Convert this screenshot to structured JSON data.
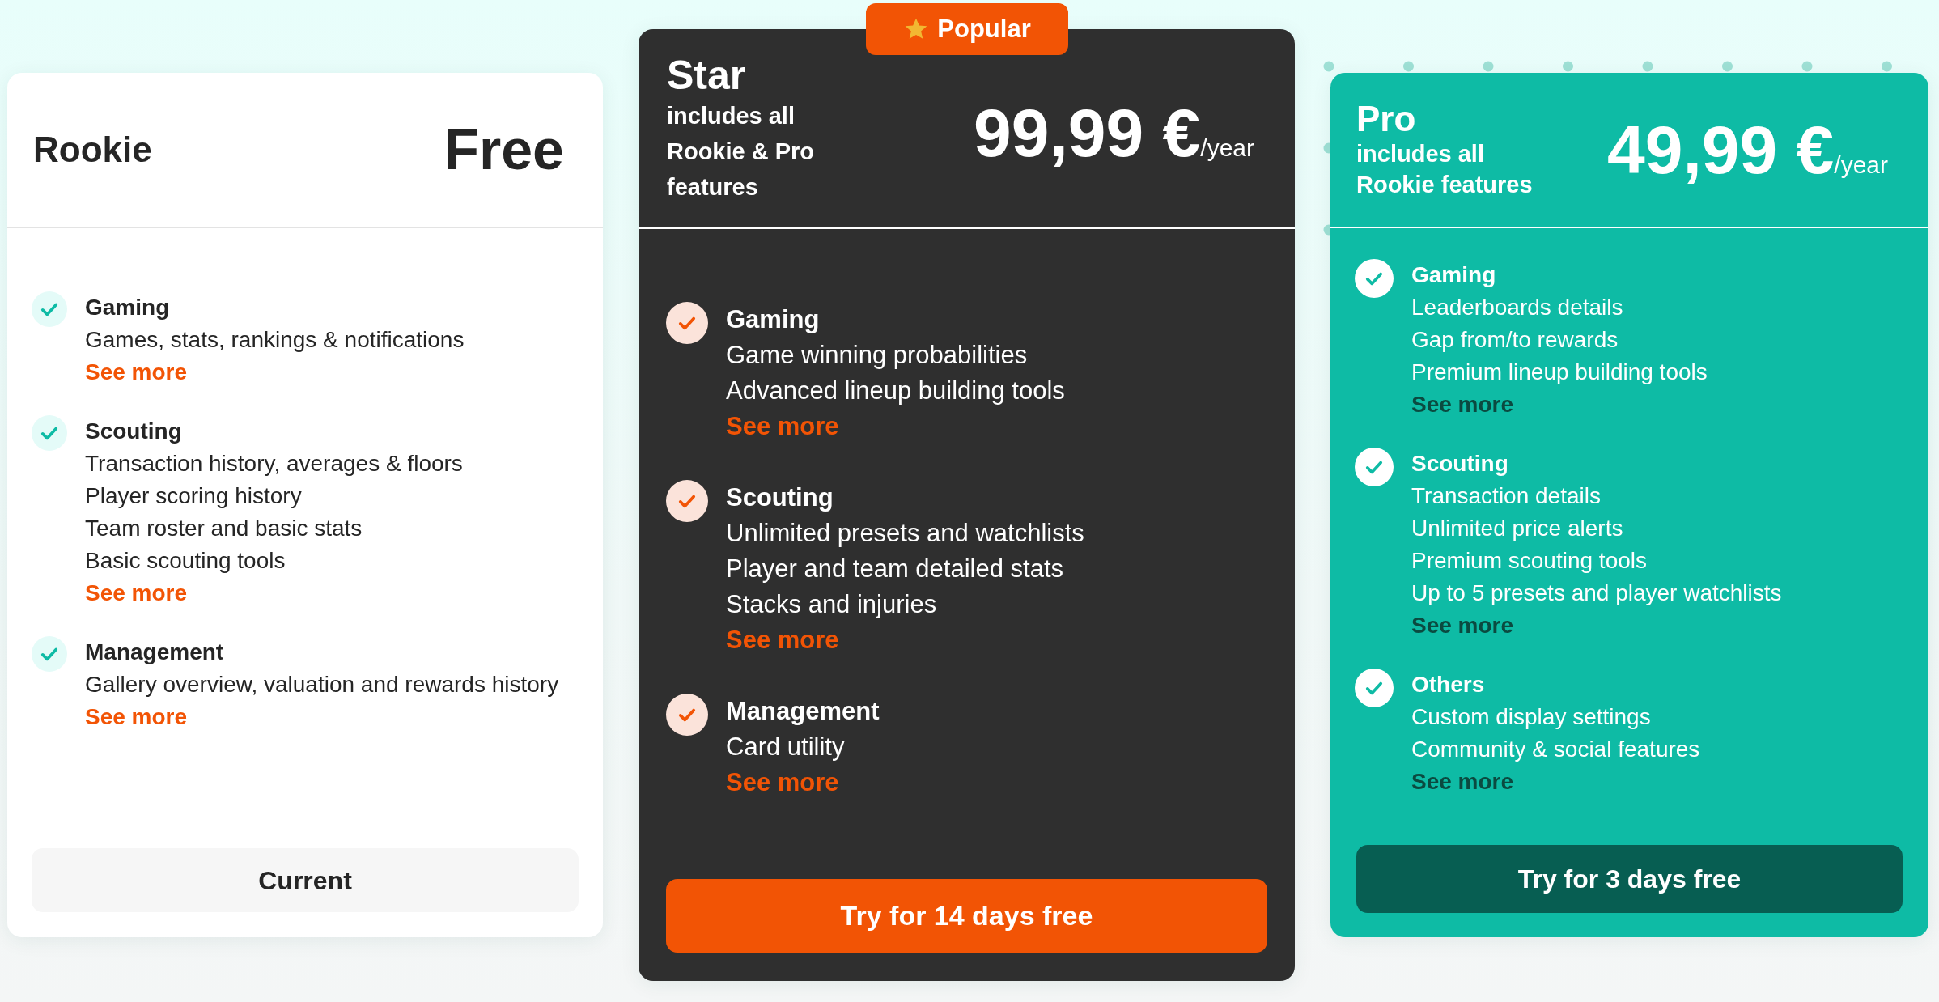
{
  "plans": [
    {
      "kind": "light",
      "name": "Rookie",
      "price": "Free",
      "groups": [
        {
          "title": "Gaming",
          "items": [
            "Games, stats, rankings & notifications"
          ],
          "link": "See more"
        },
        {
          "title": "Scouting",
          "items": [
            "Transaction history, averages & floors",
            "Player scoring history",
            "Team roster and basic stats",
            "Basic scouting tools"
          ],
          "link": "See more"
        },
        {
          "title": "Management",
          "items": [
            "Gallery overview, valuation and rewards history"
          ],
          "link": "See more"
        }
      ],
      "button": "Current"
    },
    {
      "kind": "dark",
      "badge": "Popular",
      "name": "Star",
      "subtitle": "includes all Rookie & Pro features",
      "price": "99,99 €",
      "period": "/year",
      "groups": [
        {
          "title": "Gaming",
          "items": [
            "Game winning probabilities",
            "Advanced lineup building tools"
          ],
          "link": "See more"
        },
        {
          "title": "Scouting",
          "items": [
            "Unlimited presets and watchlists",
            "Player and team detailed stats",
            "Stacks and injuries"
          ],
          "link": "See more"
        },
        {
          "title": "Management",
          "items": [
            "Card utility"
          ],
          "link": "See more"
        }
      ],
      "button": "Try for 14 days free"
    },
    {
      "kind": "teal",
      "name": "Pro",
      "subtitle": "includes all Rookie features",
      "price": "49,99 €",
      "period": "/year",
      "groups": [
        {
          "title": "Gaming",
          "items": [
            "Leaderboards details",
            "Gap from/to rewards",
            "Premium lineup building tools"
          ],
          "link": "See more"
        },
        {
          "title": "Scouting",
          "items": [
            "Transaction details",
            "Unlimited price alerts",
            "Premium scouting tools",
            "Up to 5 presets and player watchlists"
          ],
          "link": "See more"
        },
        {
          "title": "Others",
          "items": [
            "Custom display settings",
            "Community & social features"
          ],
          "link": "See more"
        }
      ],
      "button": "Try for 3 days free"
    }
  ]
}
